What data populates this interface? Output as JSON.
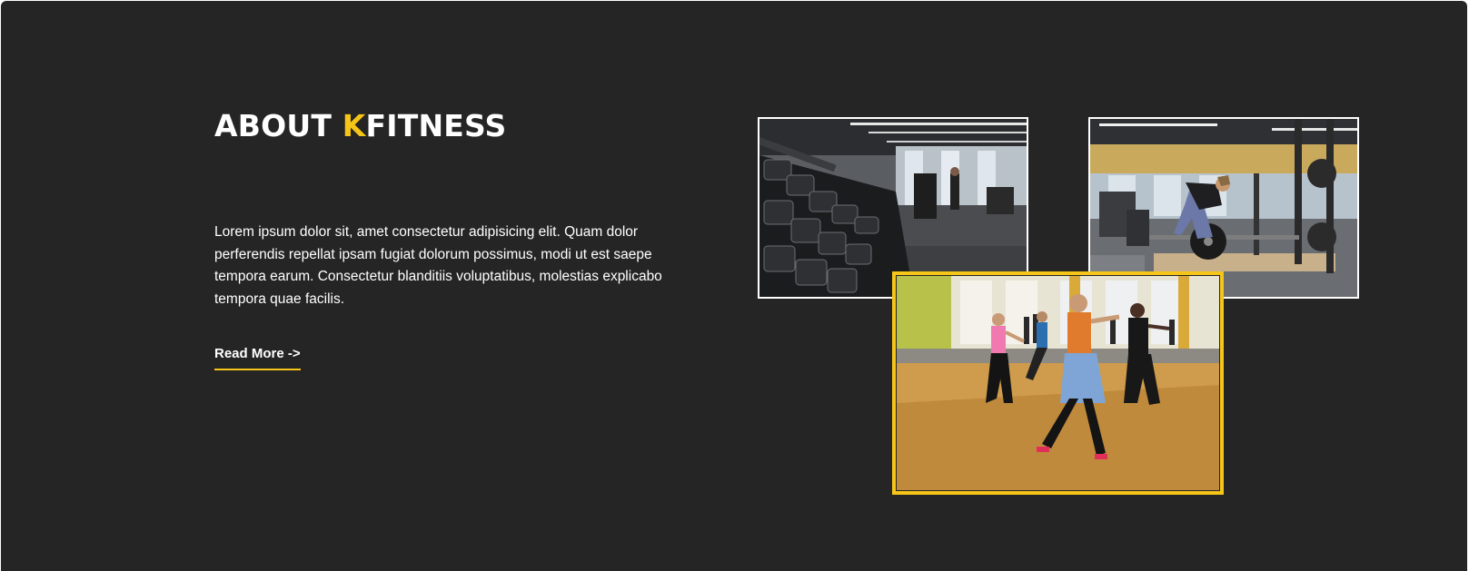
{
  "about": {
    "title_prefix": "ABOUT ",
    "title_accent": "K",
    "title_suffix": "FITNESS",
    "description": "Lorem ipsum dolor sit, amet consectetur adipisicing elit. Quam dolor perferendis repellat ipsam fugiat dolorum possimus, modi ut est saepe tempora earum. Consectetur blanditiis voluptatibus, molestias explicabo tempora quae facilis.",
    "read_more_label": "Read More ->"
  },
  "colors": {
    "background": "#252525",
    "accent": "#f5c518",
    "text": "#ffffff"
  },
  "images": [
    {
      "name": "gym-dumbbell-rack-photo"
    },
    {
      "name": "gym-deadlift-photo"
    },
    {
      "name": "dance-fitness-class-photo"
    }
  ]
}
